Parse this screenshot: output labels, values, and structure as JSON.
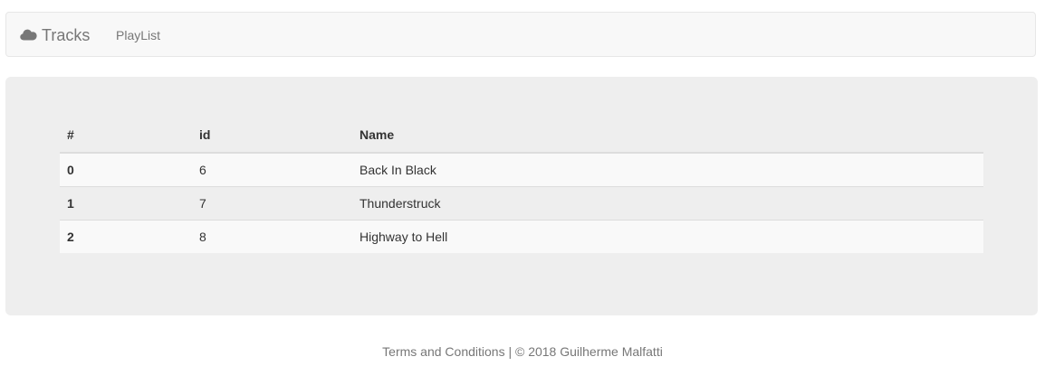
{
  "navbar": {
    "brand_icon": "cloud-icon",
    "brand_label": "Tracks",
    "link_playlist": "PlayList"
  },
  "table": {
    "headers": [
      "#",
      "id",
      "Name"
    ],
    "rows": [
      {
        "index": "0",
        "id": "6",
        "name": "Back In Black"
      },
      {
        "index": "1",
        "id": "7",
        "name": "Thunderstruck"
      },
      {
        "index": "2",
        "id": "8",
        "name": "Highway to Hell"
      }
    ]
  },
  "footer": {
    "text": "Terms and Conditions | © 2018 Guilherme Malfatti"
  },
  "colors": {
    "navbar_bg": "#f8f8f8",
    "jumbotron_bg": "#eeeeee",
    "stripe_bg": "#f9f9f9",
    "muted_text": "#777777",
    "body_text": "#333333"
  }
}
